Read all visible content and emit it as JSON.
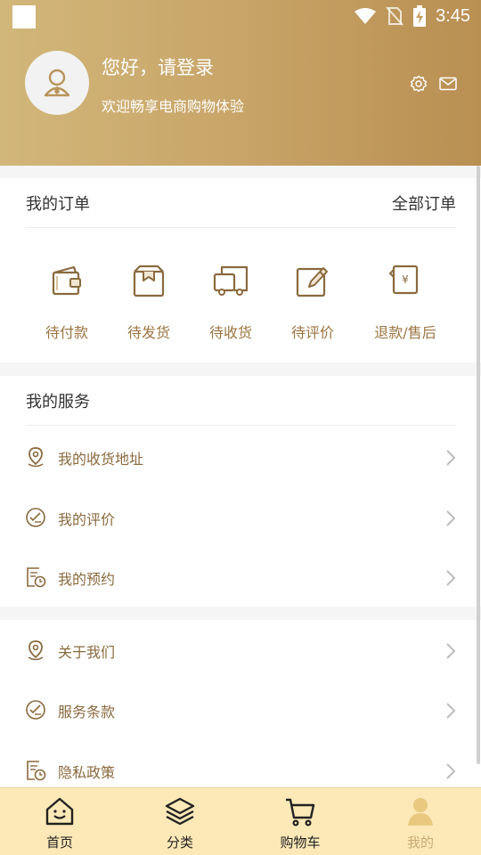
{
  "status_bar": {
    "time": "3:45"
  },
  "header": {
    "greeting": "您好，请登录",
    "welcome": "欢迎畅享电商购物体验",
    "icons": [
      "settings-icon",
      "message-icon"
    ]
  },
  "orders": {
    "title": "我的订单",
    "all_link": "全部订单",
    "items": [
      {
        "label": "待付款",
        "icon": "wallet-icon"
      },
      {
        "label": "待发货",
        "icon": "package-icon"
      },
      {
        "label": "待收货",
        "icon": "truck-icon"
      },
      {
        "label": "待评价",
        "icon": "edit-icon"
      },
      {
        "label": "退款/售后",
        "icon": "refund-icon"
      }
    ]
  },
  "services": {
    "title": "我的服务",
    "items": [
      {
        "label": "我的收货地址",
        "icon": "location-icon"
      },
      {
        "label": "我的评价",
        "icon": "review-icon"
      },
      {
        "label": "我的预约",
        "icon": "appointment-icon"
      }
    ]
  },
  "more": {
    "items": [
      {
        "label": "关于我们",
        "icon": "location-icon"
      },
      {
        "label": "服务条款",
        "icon": "review-icon"
      },
      {
        "label": "隐私政策",
        "icon": "appointment-icon"
      }
    ]
  },
  "tabbar": {
    "items": [
      {
        "label": "首页",
        "icon": "home-icon"
      },
      {
        "label": "分类",
        "icon": "layers-icon"
      },
      {
        "label": "购物车",
        "icon": "cart-icon"
      },
      {
        "label": "我的",
        "icon": "user-icon"
      }
    ],
    "active": "我的"
  },
  "colors": {
    "header_gradient_start": "#d2b77a",
    "header_gradient_end": "#b98f52",
    "accent_brown": "#9b7440",
    "tabbar_bg": "#fde9b8",
    "tab_active": "#c8a974"
  }
}
